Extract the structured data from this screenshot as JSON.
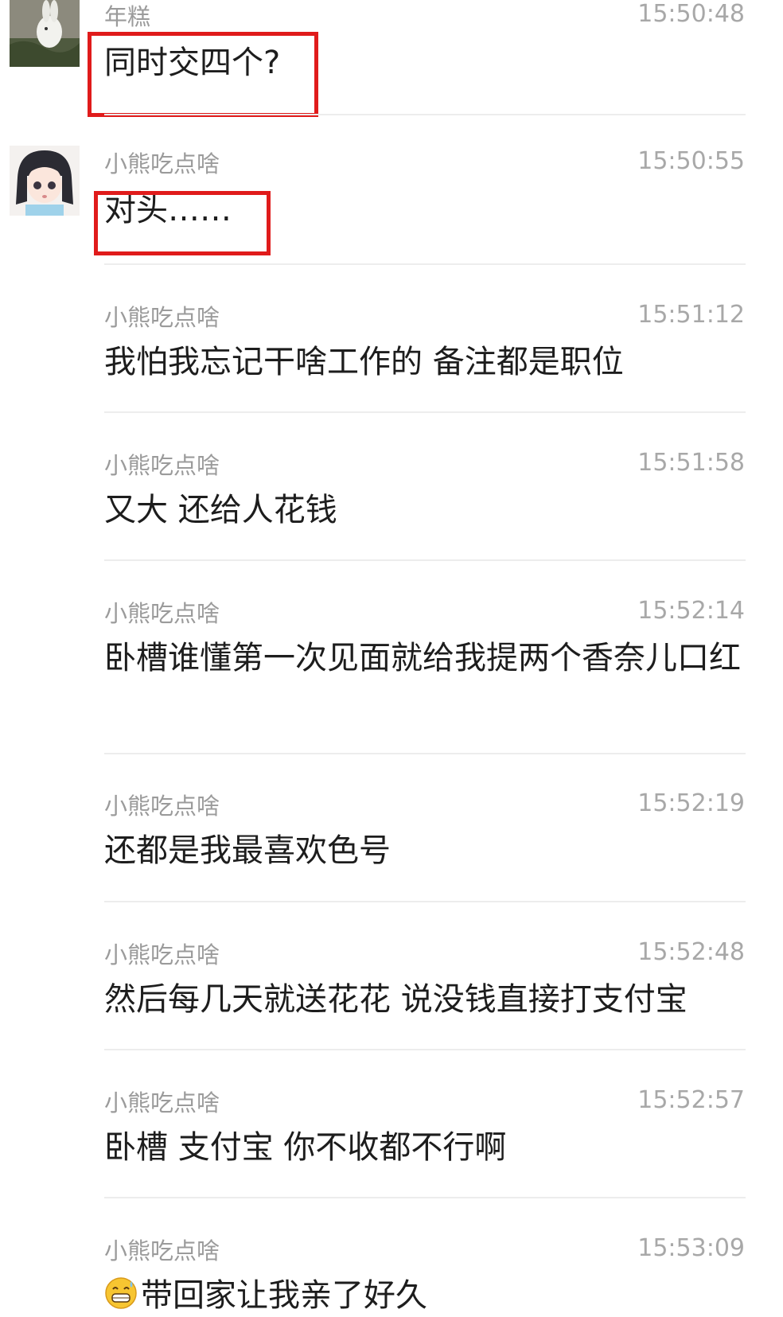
{
  "messages": [
    {
      "sender": "年糕",
      "time": "15:50:48",
      "text": "同时交四个?"
    },
    {
      "sender": "小熊吃点啥",
      "time": "15:50:55",
      "text": "对头……"
    },
    {
      "sender": "小熊吃点啥",
      "time": "15:51:12",
      "text": "我怕我忘记干啥工作的 备注都是职位"
    },
    {
      "sender": "小熊吃点啥",
      "time": "15:51:58",
      "text": "又大 还给人花钱"
    },
    {
      "sender": "小熊吃点啥",
      "time": "15:52:14",
      "text": "卧槽谁懂第一次见面就给我提两个香奈儿口红"
    },
    {
      "sender": "小熊吃点啥",
      "time": "15:52:19",
      "text": "还都是我最喜欢色号"
    },
    {
      "sender": "小熊吃点啥",
      "time": "15:52:48",
      "text": "然后每几天就送花花 说没钱直接打支付宝"
    },
    {
      "sender": "小熊吃点啥",
      "time": "15:52:57",
      "text": "卧槽 支付宝 你不收都不行啊"
    },
    {
      "sender": "小熊吃点啥",
      "time": "15:53:09",
      "text": "带回家让我亲了好久",
      "emoji": "grinning-sweat-emoji"
    }
  ],
  "colors": {
    "highlight": "#e01b1b",
    "sender": "#9b9b9b",
    "time": "#a8a8a8",
    "text": "#1d1d1d",
    "divider": "#ededed"
  },
  "avatars": {
    "m0": "rabbit-photo-avatar",
    "m1": "anime-girl-avatar"
  }
}
